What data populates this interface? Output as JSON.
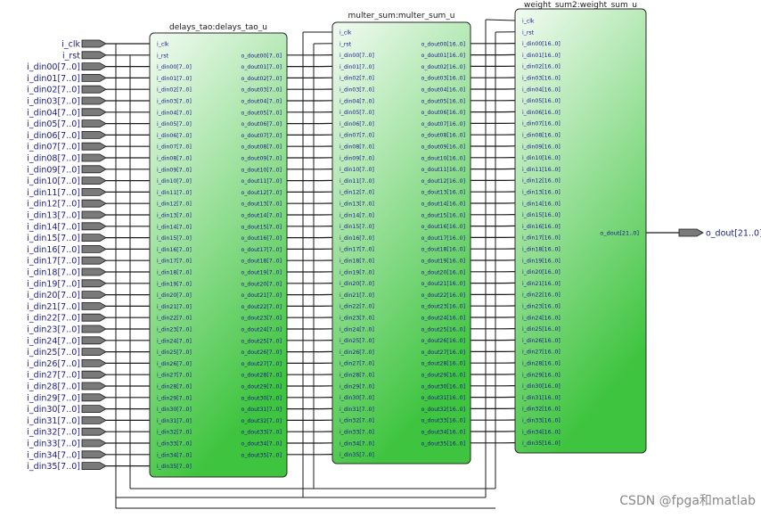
{
  "colors": {
    "wire": "#1a1a1a",
    "port_fill": "#7a7a7a",
    "block_top": "#f2fbf2",
    "block_bottom": "#3ec43e",
    "block_border": "#2a2a2a",
    "block_title": "#1a1a1a",
    "port_text": "#1a1a8c",
    "io_text": "#1a1a8c",
    "watermark": "#888888"
  },
  "inputs": [
    "i_clk",
    "i_rst",
    "i_din00[7..0]",
    "i_din01[7..0]",
    "i_din02[7..0]",
    "i_din03[7..0]",
    "i_din04[7..0]",
    "i_din05[7..0]",
    "i_din06[7..0]",
    "i_din07[7..0]",
    "i_din08[7..0]",
    "i_din09[7..0]",
    "i_din10[7..0]",
    "i_din11[7..0]",
    "i_din12[7..0]",
    "i_din13[7..0]",
    "i_din14[7..0]",
    "i_din15[7..0]",
    "i_din16[7..0]",
    "i_din17[7..0]",
    "i_din18[7..0]",
    "i_din19[7..0]",
    "i_din20[7..0]",
    "i_din21[7..0]",
    "i_din22[7..0]",
    "i_din23[7..0]",
    "i_din24[7..0]",
    "i_din25[7..0]",
    "i_din26[7..0]",
    "i_din27[7..0]",
    "i_din28[7..0]",
    "i_din29[7..0]",
    "i_din30[7..0]",
    "i_din31[7..0]",
    "i_din32[7..0]",
    "i_din33[7..0]",
    "i_din34[7..0]",
    "i_din35[7..0]"
  ],
  "output": "o_dout[21..0]",
  "blocks": [
    {
      "title": "delays_tao:delays_tao_u",
      "inputs": [
        "i_clk",
        "i_rst",
        "i_din00[7..0]",
        "i_din01[7..0]",
        "i_din02[7..0]",
        "i_din03[7..0]",
        "i_din04[7..0]",
        "i_din05[7..0]",
        "i_din06[7..0]",
        "i_din07[7..0]",
        "i_din08[7..0]",
        "i_din09[7..0]",
        "i_din10[7..0]",
        "i_din11[7..0]",
        "i_din12[7..0]",
        "i_din13[7..0]",
        "i_din14[7..0]",
        "i_din15[7..0]",
        "i_din16[7..0]",
        "i_din17[7..0]",
        "i_din18[7..0]",
        "i_din19[7..0]",
        "i_din20[7..0]",
        "i_din21[7..0]",
        "i_din22[7..0]",
        "i_din23[7..0]",
        "i_din24[7..0]",
        "i_din25[7..0]",
        "i_din26[7..0]",
        "i_din27[7..0]",
        "i_din28[7..0]",
        "i_din29[7..0]",
        "i_din30[7..0]",
        "i_din31[7..0]",
        "i_din32[7..0]",
        "i_din33[7..0]",
        "i_din34[7..0]",
        "i_din35[7..0]"
      ],
      "outputs": [
        "o_dout00[7..0]",
        "o_dout01[7..0]",
        "o_dout02[7..0]",
        "o_dout03[7..0]",
        "o_dout04[7..0]",
        "o_dout05[7..0]",
        "o_dout06[7..0]",
        "o_dout07[7..0]",
        "o_dout08[7..0]",
        "o_dout09[7..0]",
        "o_dout10[7..0]",
        "o_dout11[7..0]",
        "o_dout12[7..0]",
        "o_dout13[7..0]",
        "o_dout14[7..0]",
        "o_dout15[7..0]",
        "o_dout16[7..0]",
        "o_dout17[7..0]",
        "o_dout18[7..0]",
        "o_dout19[7..0]",
        "o_dout20[7..0]",
        "o_dout21[7..0]",
        "o_dout22[7..0]",
        "o_dout23[7..0]",
        "o_dout24[7..0]",
        "o_dout25[7..0]",
        "o_dout26[7..0]",
        "o_dout27[7..0]",
        "o_dout28[7..0]",
        "o_dout29[7..0]",
        "o_dout30[7..0]",
        "o_dout31[7..0]",
        "o_dout32[7..0]",
        "o_dout33[7..0]",
        "o_dout34[7..0]",
        "o_dout35[7..0]"
      ]
    },
    {
      "title": "multer_sum:multer_sum_u",
      "inputs": [
        "i_clk",
        "i_rst",
        "i_din00[7..0]",
        "i_din01[7..0]",
        "i_din02[7..0]",
        "i_din03[7..0]",
        "i_din04[7..0]",
        "i_din05[7..0]",
        "i_din06[7..0]",
        "i_din07[7..0]",
        "i_din08[7..0]",
        "i_din09[7..0]",
        "i_din10[7..0]",
        "i_din11[7..0]",
        "i_din12[7..0]",
        "i_din13[7..0]",
        "i_din14[7..0]",
        "i_din15[7..0]",
        "i_din16[7..0]",
        "i_din17[7..0]",
        "i_din18[7..0]",
        "i_din19[7..0]",
        "i_din20[7..0]",
        "i_din21[7..0]",
        "i_din22[7..0]",
        "i_din23[7..0]",
        "i_din24[7..0]",
        "i_din25[7..0]",
        "i_din26[7..0]",
        "i_din27[7..0]",
        "i_din28[7..0]",
        "i_din29[7..0]",
        "i_din30[7..0]",
        "i_din31[7..0]",
        "i_din32[7..0]",
        "i_din33[7..0]",
        "i_din34[7..0]",
        "i_din35[7..0]"
      ],
      "outputs": [
        "o_dout00[16..0]",
        "o_dout01[16..0]",
        "o_dout02[16..0]",
        "o_dout03[16..0]",
        "o_dout04[16..0]",
        "o_dout05[16..0]",
        "o_dout06[16..0]",
        "o_dout07[16..0]",
        "o_dout08[16..0]",
        "o_dout09[16..0]",
        "o_dout10[16..0]",
        "o_dout11[16..0]",
        "o_dout12[16..0]",
        "o_dout13[16..0]",
        "o_dout14[16..0]",
        "o_dout15[16..0]",
        "o_dout16[16..0]",
        "o_dout17[16..0]",
        "o_dout18[16..0]",
        "o_dout19[16..0]",
        "o_dout20[16..0]",
        "o_dout21[16..0]",
        "o_dout22[16..0]",
        "o_dout23[16..0]",
        "o_dout24[16..0]",
        "o_dout25[16..0]",
        "o_dout26[16..0]",
        "o_dout27[16..0]",
        "o_dout28[16..0]",
        "o_dout29[16..0]",
        "o_dout30[16..0]",
        "o_dout31[16..0]",
        "o_dout32[16..0]",
        "o_dout33[16..0]",
        "o_dout34[16..0]",
        "o_dout35[16..0]"
      ]
    },
    {
      "title": "weight_sum2:weight_sum_u",
      "inputs": [
        "i_clk",
        "i_rst",
        "i_din00[16..0]",
        "i_din01[16..0]",
        "i_din02[16..0]",
        "i_din03[16..0]",
        "i_din04[16..0]",
        "i_din05[16..0]",
        "i_din06[16..0]",
        "i_din07[16..0]",
        "i_din08[16..0]",
        "i_din09[16..0]",
        "i_din10[16..0]",
        "i_din11[16..0]",
        "i_din12[16..0]",
        "i_din13[16..0]",
        "i_din14[16..0]",
        "i_din15[16..0]",
        "i_din16[16..0]",
        "i_din17[16..0]",
        "i_din18[16..0]",
        "i_din19[16..0]",
        "i_din20[16..0]",
        "i_din21[16..0]",
        "i_din22[16..0]",
        "i_din23[16..0]",
        "i_din24[16..0]",
        "i_din25[16..0]",
        "i_din26[16..0]",
        "i_din27[16..0]",
        "i_din28[16..0]",
        "i_din29[16..0]",
        "i_din30[16..0]",
        "i_din31[16..0]",
        "i_din32[16..0]",
        "i_din33[16..0]",
        "i_din34[16..0]",
        "i_din35[16..0]"
      ],
      "outputs": [
        "o_dout[21..0]"
      ]
    }
  ],
  "watermark": "CSDN @fpga和matlab"
}
